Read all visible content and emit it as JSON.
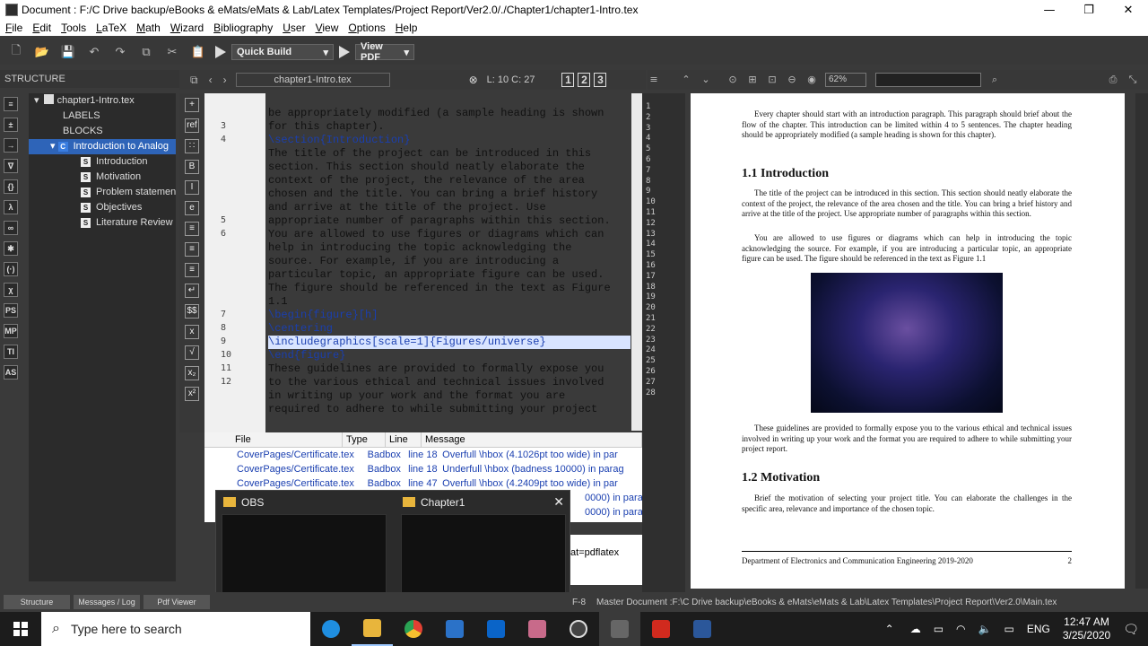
{
  "window": {
    "title": "Document : F:/C Drive backup/eBooks & eMats/eMats & Lab/Latex Templates/Project Report/Ver2.0/./Chapter1/chapter1-Intro.tex"
  },
  "menu": [
    "File",
    "Edit",
    "Tools",
    "LaTeX",
    "Math",
    "Wizard",
    "Bibliography",
    "User",
    "View",
    "Options",
    "Help"
  ],
  "toolbar": {
    "quick_build": "Quick Build",
    "view_pdf": "View PDF"
  },
  "structure": {
    "header": "STRUCTURE",
    "file": "chapter1-Intro.tex",
    "labels": "LABELS",
    "blocks": "BLOCKS",
    "chapter": "Introduction to Analog",
    "sections": [
      "Introduction",
      "Motivation",
      "Problem statement",
      "Objectives",
      "Literature Review"
    ]
  },
  "editor": {
    "tab": "chapter1-Intro.tex",
    "cursor": "L: 10 C: 27",
    "line_numbers": [
      "3",
      "4",
      "5",
      "6",
      "7",
      "8",
      "9",
      "10",
      "11",
      "12"
    ],
    "lines": [
      "be appropriately modified (a sample heading is shown",
      "for this chapter).",
      "\\section{Introduction}",
      "The title of the project can be introduced in this",
      "section. This section should neatly elaborate the",
      "context of the project, the relevance of the area",
      "chosen and the title. You can bring a brief history",
      "and arrive at the title of the project. Use",
      "appropriate number of paragraphs within this section.",
      "",
      "You are allowed to use figures or diagrams which can",
      "help in introducing the topic acknowledging the",
      "source. For example, if you are introducing a",
      "particular topic, an appropriate figure can be used.",
      "The figure should be referenced in the text as Figure",
      "1.1",
      "",
      "\\begin{figure}[h]",
      "\\centering",
      "\\includegraphics[scale=1]{Figures/universe}",
      "\\end{figure}",
      "These guidelines are provided to formally expose you",
      "to the various ethical and technical issues involved",
      "in writing up your work and the format you are",
      "required to adhere to while submitting your project"
    ]
  },
  "minimap_numbers": [
    "1",
    "2",
    "3",
    "4",
    "5",
    "6",
    "7",
    "8",
    "9",
    "10",
    "11",
    "12",
    "13",
    "14",
    "15",
    "16",
    "17",
    "18",
    "19",
    "20",
    "21",
    "22",
    "23",
    "24",
    "25",
    "26",
    "27",
    "28"
  ],
  "log": {
    "headers": [
      "File",
      "Type",
      "Line",
      "Message"
    ],
    "rows": [
      {
        "file": "CoverPages/Certificate.tex",
        "type": "Badbox",
        "line": "line 18",
        "msg": "Overfull \\hbox (4.1026pt too wide) in par"
      },
      {
        "file": "CoverPages/Certificate.tex",
        "type": "Badbox",
        "line": "line 18",
        "msg": "Underfull \\hbox (badness 10000) in parag"
      },
      {
        "file": "CoverPages/Certificate.tex",
        "type": "Badbox",
        "line": "line 47",
        "msg": "Overfull \\hbox (4.2409pt too wide) in par"
      }
    ],
    "partial1": "0000) in parag",
    "partial2": "0000) in parag",
    "cmd_tail": "at=pdflatex"
  },
  "thumbnails": [
    {
      "title": "OBS"
    },
    {
      "title": "Chapter1"
    }
  ],
  "pdf": {
    "zoom": "62%",
    "intro_para": "Every chapter should start with an introduction paragraph. This paragraph should brief about the flow of the chapter. This introduction can be limited within 4 to 5 sentences. The chapter heading should be appropriately modified (a sample heading is shown for this chapter).",
    "h1": "1.1 Introduction",
    "para1": "The title of the project can be introduced in this section. This section should neatly elaborate the context of the project, the relevance of the area chosen and the title. You can bring a brief history and arrive at the title of the project. Use appropriate number of paragraphs within this section.",
    "para2": "You are allowed to use figures or diagrams which can help in introducing the topic acknowledging the source. For example, if you are introducing a particular topic, an appropriate figure can be used. The figure should be referenced in the text as Figure 1.1",
    "para3": "These guidelines are provided to formally expose you to the various ethical and technical issues involved in writing up your work and the format you are required to adhere to while submitting your project report.",
    "h2": "1.2 Motivation",
    "para4": "Brief the motivation of selecting your project title. You can elaborate the challenges in the specific area, relevance and importance of the chosen topic.",
    "footer_left": "Department of Electronics and Communication Engineering 2019-2020",
    "footer_right": "2"
  },
  "statusbar": {
    "tabs": [
      "Structure",
      "Messages / Log",
      "Pdf Viewer"
    ],
    "encoding_tail": "F-8",
    "master": "Master Document :F:\\C Drive backup\\eBooks & eMats\\eMats & Lab\\Latex Templates\\Project Report\\Ver2.0\\Main.tex"
  },
  "taskbar": {
    "search_placeholder": "Type here to search",
    "lang": "ENG",
    "time": "12:47 AM",
    "date": "3/25/2020"
  }
}
